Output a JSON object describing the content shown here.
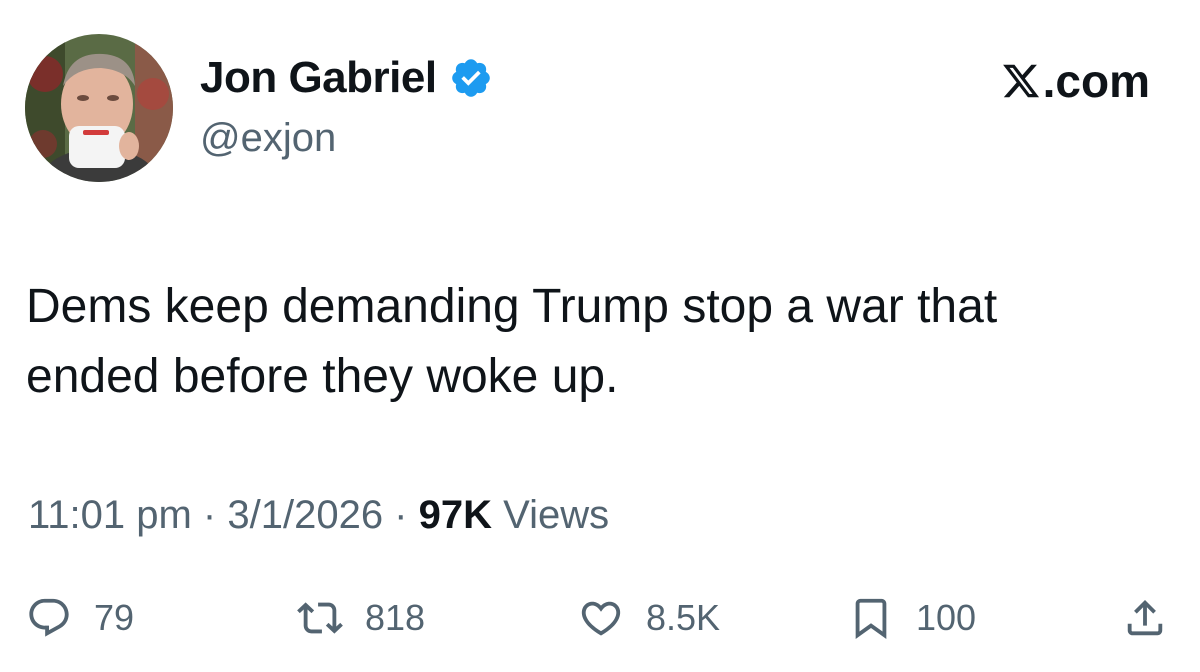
{
  "author": {
    "display_name": "Jon Gabriel",
    "handle": "@exjon",
    "verified": true,
    "verified_color": "#1d9bf0",
    "avatar_icon": "profile-photo"
  },
  "brand": {
    "label": ".com",
    "icon": "x-logo-icon"
  },
  "tweet": {
    "text_line1": "Dems keep demanding Trump stop a war that",
    "text_line2": "ended before they woke up."
  },
  "meta": {
    "time": "11:01 pm",
    "date": "3/1/2026",
    "separator": " · ",
    "views_count": "97K",
    "views_label": "Views"
  },
  "actions": {
    "replies": "79",
    "reposts": "818",
    "likes": "8.5K",
    "bookmarks": "100"
  },
  "colors": {
    "text_primary": "#0f1419",
    "text_secondary": "#536471"
  }
}
